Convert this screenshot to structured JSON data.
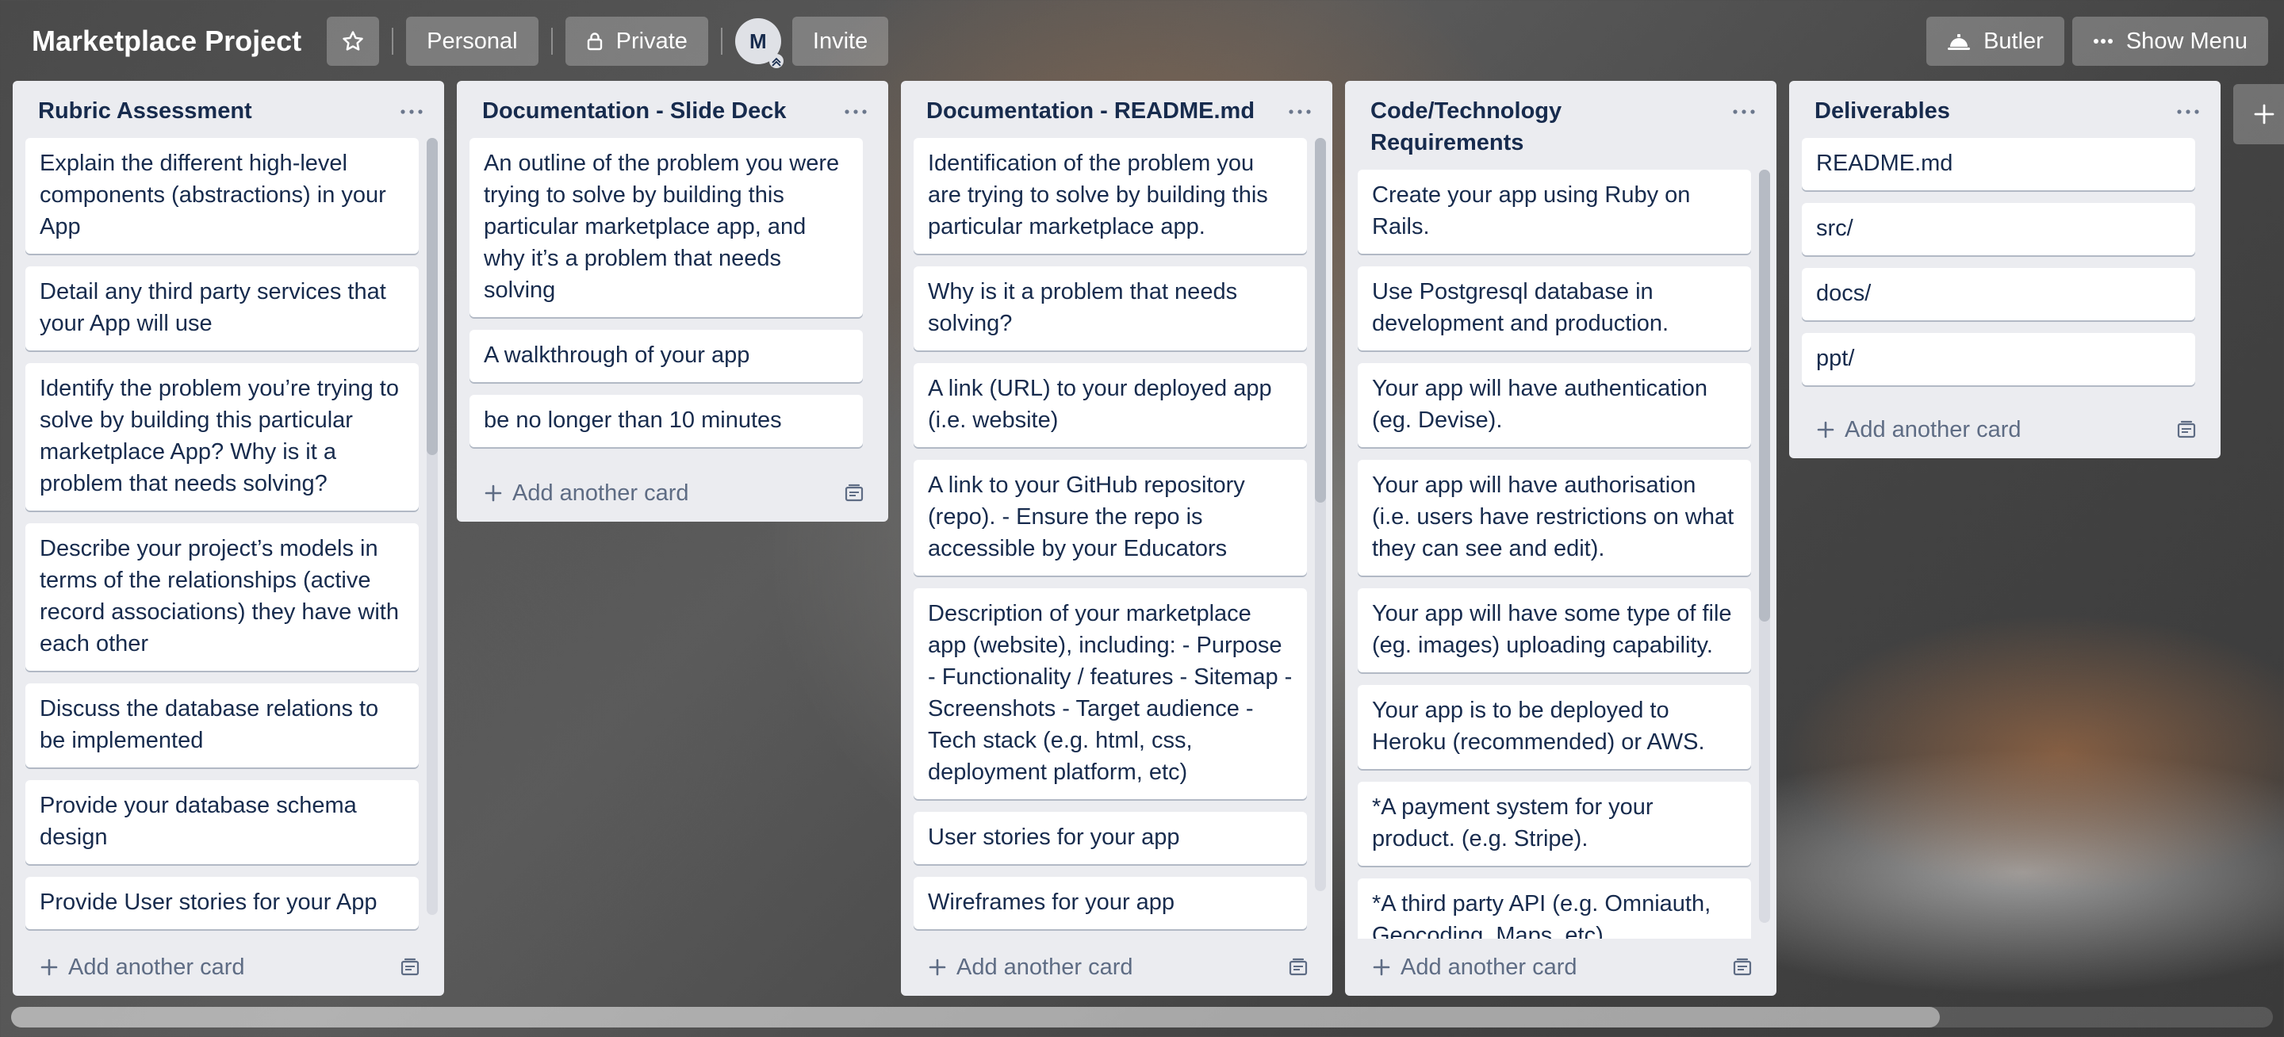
{
  "header": {
    "board_title": "Marketplace Project",
    "star_icon": "star-icon",
    "workspace_label": "Personal",
    "visibility_label": "Private",
    "visibility_icon": "lock-icon",
    "member_initial": "M",
    "invite_label": "Invite",
    "butler_label": "Butler",
    "butler_icon": "butler-bell-icon",
    "menu_label": "Show Menu",
    "menu_icon": "ellipsis-icon"
  },
  "add_card_label": "Add another card",
  "lists": [
    {
      "title": "Rubric Assessment",
      "cards": [
        "Explain the different high-level components (abstractions) in your App",
        "Detail any third party services that your App will use",
        "Identify the problem you’re trying to solve by building this particular marketplace App? Why is it a problem that needs solving?",
        "Describe your project’s models in terms of the relationships (active record associations) they have with each other",
        "Discuss the database relations to be implemented",
        "Provide your database schema design",
        "Provide User stories for your App"
      ]
    },
    {
      "title": "Documentation - Slide Deck",
      "cards": [
        "An outline of the problem you were trying to solve by building this particular marketplace app, and why it’s a problem that needs solving",
        "A walkthrough of your app",
        "be no longer than 10 minutes"
      ]
    },
    {
      "title": "Documentation - README.md",
      "cards": [
        "Identification of the problem you are trying to solve by building this particular marketplace app.",
        "Why is it a problem that needs solving?",
        "A link (URL) to your deployed app (i.e. website)",
        "A link to your GitHub repository (repo). - Ensure the repo is accessible by your Educators",
        "Description of your marketplace app (website), including: - Purpose - Functionality / features - Sitemap - Screenshots - Target audience - Tech stack (e.g. html, css, deployment platform, etc)",
        "User stories for your app",
        "Wireframes for your app"
      ]
    },
    {
      "title": "Code/Technology Requirements",
      "cards": [
        "Create your app using Ruby on Rails.",
        "Use Postgresql database in development and production.",
        "Your app will have authentication (eg. Devise).",
        "Your app will have authorisation (i.e. users have restrictions on what they can see and edit).",
        "Your app will have some type of file (eg. images) uploading capability.",
        "Your app is to be deployed to Heroku (recommended) or AWS.",
        "*A payment system for your product. (e.g. Stripe).",
        "*A third party API (e.g. Omniauth, Geocoding, Maps, etc)"
      ]
    },
    {
      "title": "Deliverables",
      "cards": [
        "README.md",
        "src/",
        "docs/",
        "ppt/"
      ]
    }
  ]
}
